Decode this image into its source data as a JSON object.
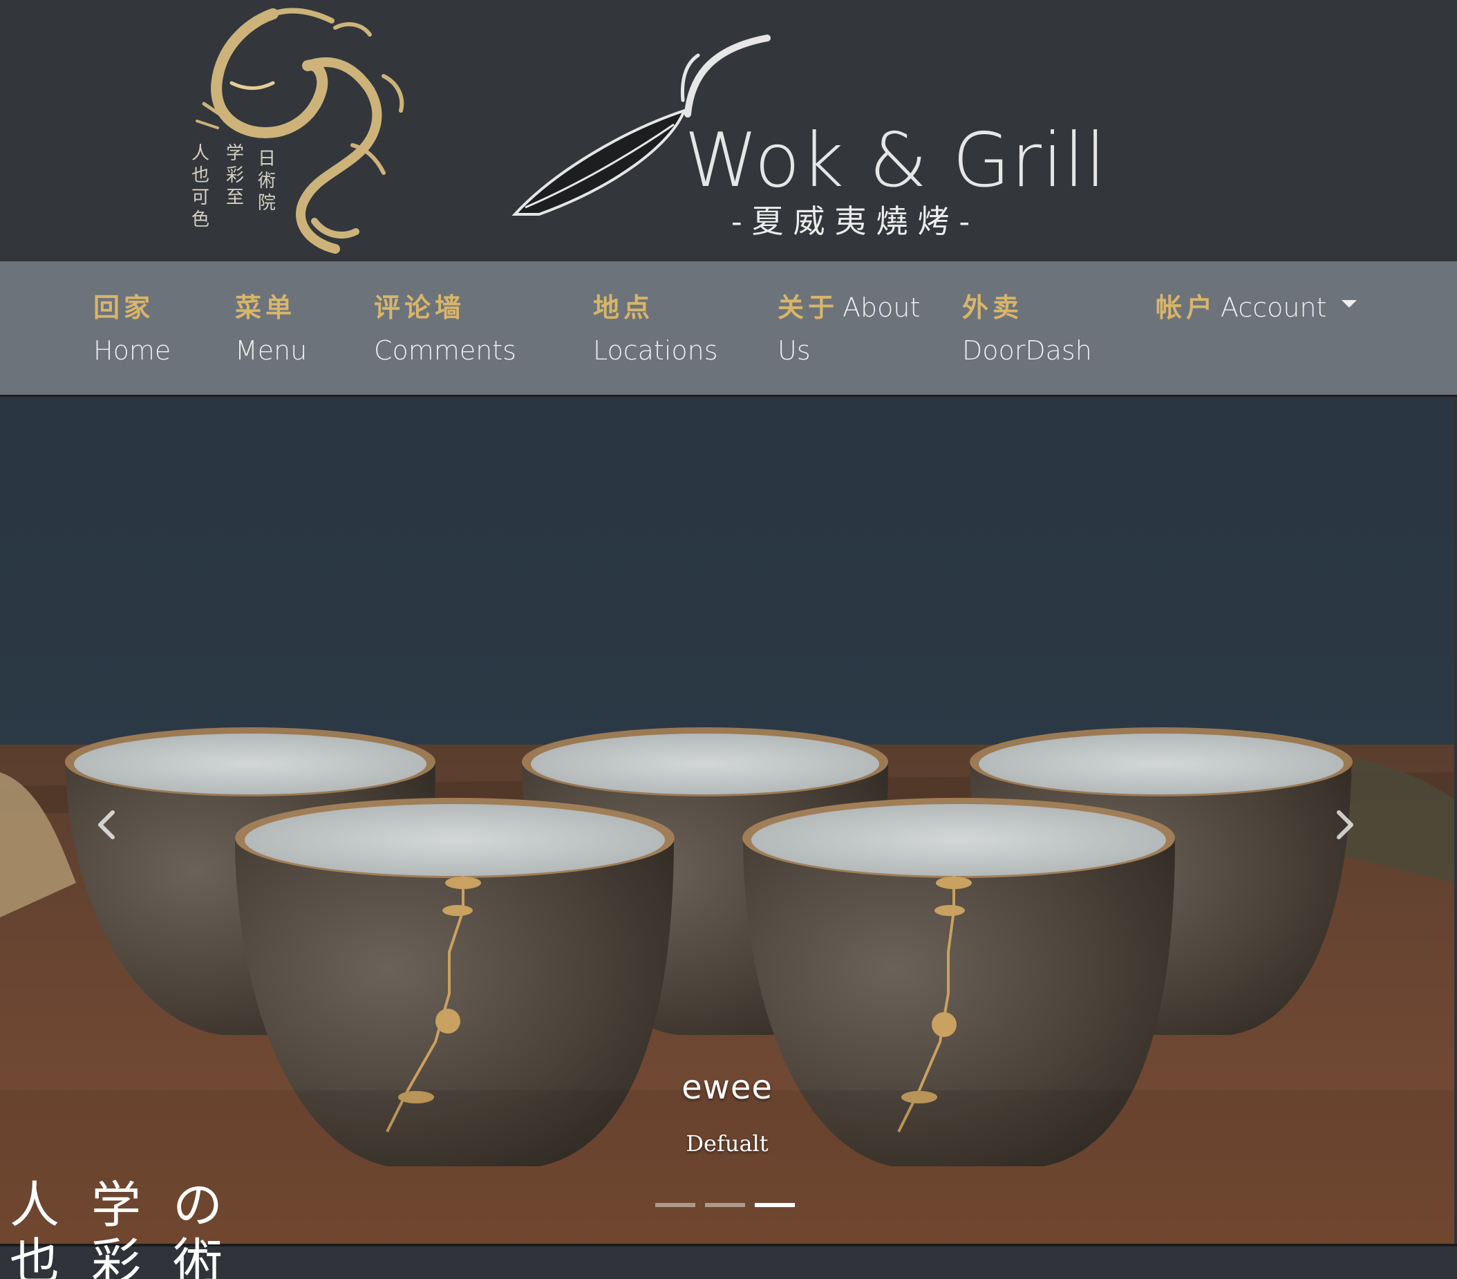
{
  "header": {
    "brand_name": "Wok & Grill",
    "brand_subtitle": "-夏威夷燒烤-",
    "dragon_logo_icon": "gold-dragon-calligraphy-logo",
    "wok_logo_icon": "wok-brushstroke-logo"
  },
  "nav": {
    "items": [
      {
        "zh": "回家",
        "en": "Home"
      },
      {
        "zh": "菜单",
        "en": "Menu"
      },
      {
        "zh": "评论墙",
        "en": "Comments"
      },
      {
        "zh": "地点",
        "en": "Locations"
      },
      {
        "zh": "关于",
        "en_inline": "About",
        "en": "Us"
      },
      {
        "zh": "外卖",
        "en": "DoorDash"
      },
      {
        "zh": "帐户",
        "en_inline": "Account",
        "dropdown": true
      }
    ],
    "text_color": "#eeeeee",
    "zh_color": "#d8b56a",
    "background": "#6c737b"
  },
  "carousel": {
    "image_subject": "five dark ceramic tea cups with gold floral pattern on wooden table",
    "caption_title": "ewee",
    "caption_text": "Defualt",
    "prev_icon": "chevron-left-icon",
    "next_icon": "chevron-right-icon",
    "slide_count": 3,
    "active_slide": 3
  },
  "colors": {
    "header_bg": "#33373c",
    "accent_gold": "#d8b56a"
  }
}
